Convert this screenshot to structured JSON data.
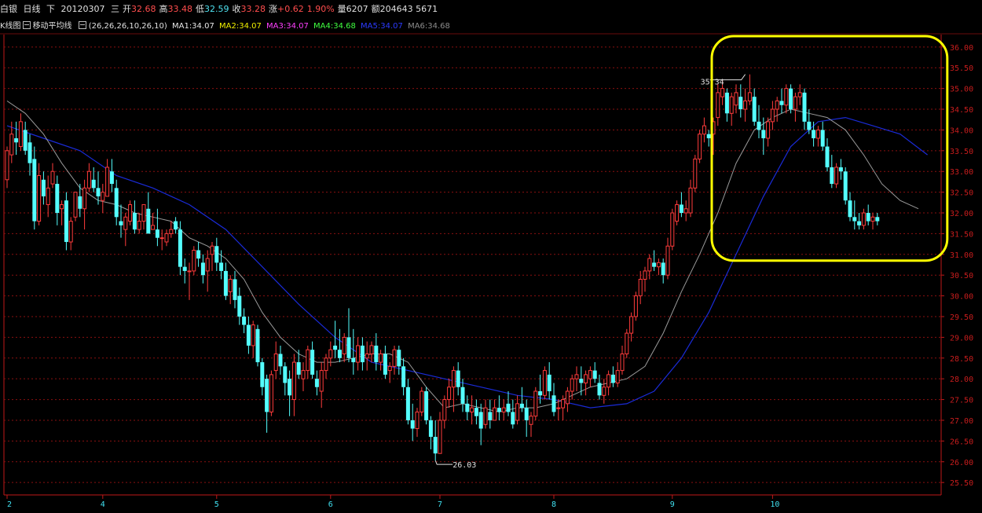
{
  "header": {
    "name": "白银",
    "period": "日线",
    "direction": "下",
    "date": "20120307",
    "weekday": "三",
    "open_label": "开",
    "open": "32.68",
    "high_label": "高",
    "high": "33.48",
    "low_label": "低",
    "low": "32.59",
    "close_label": "收",
    "close": "33.28",
    "change_label": "涨",
    "change": "+0.62",
    "change_pct": "1.90%",
    "volume_label": "量",
    "volume": "6207",
    "amount_label": "额",
    "amount": "204643 5671"
  },
  "indicator_bar": {
    "kline_label": "K线图",
    "ma_label": "移动平均线",
    "ma_params": "(26,26,26,10,26,10)",
    "ma1": "MA1:34.07",
    "ma2": "MA2:34.07",
    "ma3": "MA3:34.07",
    "ma4": "MA4:34.68",
    "ma5": "MA5:34.07",
    "ma6": "MA6:34.68"
  },
  "colors": {
    "up": "#ff3b3b",
    "down": "#54ffff",
    "ma_short": "#9a9a9a",
    "ma_long": "#1a2bd8",
    "grid": "#8a1010",
    "axis": "#c01818",
    "highlight": "#ffff00"
  },
  "chart_data": {
    "type": "candlestick",
    "yticks": [
      "25.50",
      "26.00",
      "26.50",
      "27.00",
      "27.50",
      "28.00",
      "28.50",
      "29.00",
      "29.50",
      "30.00",
      "30.50",
      "31.00",
      "31.50",
      "32.00",
      "32.50",
      "33.00",
      "33.50",
      "34.00",
      "34.50",
      "35.00",
      "35.50",
      "36.00"
    ],
    "ylim": [
      25.2,
      36.3
    ],
    "xticks": [
      {
        "label": "2",
        "index": 0
      },
      {
        "label": "4",
        "index": 21
      },
      {
        "label": "5",
        "index": 46
      },
      {
        "label": "6",
        "index": 71
      },
      {
        "label": "7",
        "index": 95
      },
      {
        "label": "8",
        "index": 120
      },
      {
        "label": "9",
        "index": 146
      },
      {
        "label": "10",
        "index": 168
      }
    ],
    "annotations": [
      {
        "text": "35.34",
        "index": 162
      },
      {
        "text": "26.03",
        "index": 94
      }
    ],
    "highlight_range": {
      "x_index": [
        155,
        206
      ],
      "y": [
        30.85,
        36.75
      ]
    },
    "ohlc": [
      [
        32.8,
        33.6,
        32.6,
        33.5
      ],
      [
        33.4,
        34.2,
        33.2,
        33.9
      ],
      [
        33.8,
        34.2,
        33.4,
        33.7
      ],
      [
        33.6,
        34.4,
        33.5,
        34.2
      ],
      [
        34.0,
        34.2,
        33.4,
        33.5
      ],
      [
        33.7,
        33.9,
        32.9,
        33.2
      ],
      [
        33.3,
        33.6,
        31.6,
        31.8
      ],
      [
        31.8,
        33.2,
        31.7,
        32.9
      ],
      [
        32.8,
        33.0,
        32.2,
        32.4
      ],
      [
        32.2,
        32.9,
        31.9,
        32.6
      ],
      [
        32.7,
        33.2,
        32.6,
        33.0
      ],
      [
        32.7,
        32.9,
        31.7,
        32.0
      ],
      [
        32.1,
        32.3,
        31.7,
        32.2
      ],
      [
        32.3,
        32.5,
        31.1,
        31.3
      ],
      [
        31.3,
        31.9,
        31.1,
        31.8
      ],
      [
        31.9,
        32.5,
        31.8,
        32.5
      ],
      [
        32.4,
        32.7,
        31.9,
        32.1
      ],
      [
        32.1,
        32.8,
        31.6,
        32.6
      ],
      [
        32.6,
        33.2,
        32.5,
        33.0
      ],
      [
        32.8,
        33.1,
        32.5,
        32.6
      ],
      [
        32.6,
        33.0,
        32.2,
        32.4
      ],
      [
        32.3,
        32.7,
        32.0,
        32.5
      ],
      [
        32.4,
        33.3,
        32.4,
        33.1
      ],
      [
        33.0,
        33.3,
        32.5,
        32.7
      ],
      [
        32.6,
        32.8,
        31.7,
        31.9
      ],
      [
        31.8,
        32.2,
        31.4,
        31.7
      ],
      [
        31.6,
        32.0,
        31.2,
        31.9
      ],
      [
        31.8,
        32.3,
        31.7,
        32.2
      ],
      [
        32.0,
        32.3,
        31.5,
        31.6
      ],
      [
        31.6,
        32.0,
        31.5,
        31.8
      ],
      [
        31.8,
        32.2,
        31.6,
        32.2
      ],
      [
        32.1,
        32.5,
        31.6,
        31.5
      ],
      [
        31.6,
        32.0,
        31.6,
        31.7
      ],
      [
        31.6,
        32.1,
        31.2,
        31.4
      ],
      [
        31.4,
        31.6,
        31.1,
        31.4
      ],
      [
        31.3,
        31.6,
        31.2,
        31.5
      ],
      [
        31.5,
        31.8,
        31.4,
        31.6
      ],
      [
        31.8,
        31.9,
        31.5,
        31.6
      ],
      [
        31.6,
        31.8,
        30.5,
        30.7
      ],
      [
        30.7,
        30.9,
        30.3,
        30.6
      ],
      [
        30.6,
        30.8,
        29.9,
        30.6
      ],
      [
        30.6,
        31.2,
        30.5,
        31.1
      ],
      [
        31.1,
        31.3,
        30.7,
        30.9
      ],
      [
        30.8,
        31.0,
        30.3,
        30.5
      ],
      [
        30.6,
        31.1,
        30.1,
        30.9
      ],
      [
        31.0,
        31.3,
        30.6,
        31.2
      ],
      [
        31.2,
        31.4,
        30.6,
        30.8
      ],
      [
        30.8,
        31.1,
        30.4,
        30.6
      ],
      [
        30.6,
        30.8,
        29.9,
        30.0
      ],
      [
        30.1,
        30.5,
        29.8,
        30.4
      ],
      [
        30.4,
        30.6,
        29.7,
        29.9
      ],
      [
        30.0,
        30.2,
        29.3,
        29.5
      ],
      [
        29.5,
        29.7,
        29.1,
        29.3
      ],
      [
        29.3,
        29.5,
        28.6,
        28.8
      ],
      [
        28.8,
        29.4,
        28.5,
        29.3
      ],
      [
        29.2,
        29.3,
        28.3,
        28.4
      ],
      [
        28.4,
        28.5,
        27.6,
        27.8
      ],
      [
        28.0,
        28.1,
        26.7,
        27.2
      ],
      [
        27.2,
        28.2,
        27.1,
        28.1
      ],
      [
        28.2,
        28.9,
        28.0,
        28.6
      ],
      [
        28.6,
        28.8,
        28.1,
        28.3
      ],
      [
        28.3,
        28.4,
        27.6,
        27.9
      ],
      [
        28.0,
        28.2,
        27.1,
        27.6
      ],
      [
        27.5,
        28.6,
        27.1,
        28.4
      ],
      [
        28.4,
        28.7,
        28.0,
        28.1
      ],
      [
        28.0,
        28.4,
        27.7,
        28.2
      ],
      [
        28.2,
        28.8,
        28.0,
        28.7
      ],
      [
        28.7,
        28.9,
        28.0,
        28.1
      ],
      [
        28.0,
        28.2,
        27.6,
        27.8
      ],
      [
        27.7,
        28.4,
        27.3,
        28.2
      ],
      [
        28.2,
        28.6,
        28.0,
        28.5
      ],
      [
        28.5,
        28.9,
        28.3,
        28.7
      ],
      [
        28.8,
        29.4,
        28.5,
        28.7
      ],
      [
        28.7,
        29.2,
        28.4,
        28.5
      ],
      [
        28.6,
        29.1,
        28.4,
        29.0
      ],
      [
        29.0,
        29.7,
        28.4,
        28.5
      ],
      [
        28.5,
        29.2,
        28.1,
        28.4
      ],
      [
        28.4,
        29.0,
        28.2,
        28.8
      ],
      [
        28.8,
        29.0,
        28.2,
        28.4
      ],
      [
        28.5,
        28.9,
        28.2,
        28.6
      ],
      [
        28.6,
        28.9,
        28.4,
        28.8
      ],
      [
        28.8,
        29.1,
        28.2,
        28.4
      ],
      [
        28.4,
        28.7,
        28.2,
        28.6
      ],
      [
        28.6,
        28.8,
        28.0,
        28.1
      ],
      [
        28.2,
        28.4,
        27.9,
        28.3
      ],
      [
        28.3,
        28.8,
        28.1,
        28.7
      ],
      [
        28.7,
        28.8,
        28.1,
        28.3
      ],
      [
        28.3,
        28.5,
        27.6,
        27.8
      ],
      [
        27.8,
        28.0,
        26.9,
        27.0
      ],
      [
        27.0,
        27.4,
        26.5,
        26.8
      ],
      [
        26.8,
        27.3,
        26.6,
        27.2
      ],
      [
        27.2,
        27.8,
        27.1,
        27.7
      ],
      [
        27.7,
        27.8,
        26.9,
        27.0
      ],
      [
        27.0,
        27.1,
        26.3,
        26.6
      ],
      [
        26.6,
        27.0,
        26.03,
        26.2
      ],
      [
        26.2,
        27.2,
        26.2,
        27.0
      ],
      [
        27.0,
        27.6,
        26.8,
        27.5
      ],
      [
        27.5,
        28.0,
        27.3,
        27.8
      ],
      [
        27.8,
        28.3,
        27.2,
        28.2
      ],
      [
        28.2,
        28.4,
        27.6,
        27.8
      ],
      [
        27.8,
        28.0,
        27.2,
        27.4
      ],
      [
        27.4,
        27.6,
        27.0,
        27.2
      ],
      [
        27.2,
        27.6,
        26.9,
        27.3
      ],
      [
        27.3,
        27.5,
        26.9,
        27.1
      ],
      [
        27.2,
        27.4,
        26.4,
        26.8
      ],
      [
        26.9,
        27.5,
        26.8,
        27.3
      ],
      [
        27.2,
        27.5,
        26.8,
        27.0
      ],
      [
        27.0,
        27.5,
        27.0,
        27.3
      ],
      [
        27.3,
        27.6,
        27.0,
        27.2
      ],
      [
        27.2,
        27.5,
        27.0,
        27.3
      ],
      [
        27.4,
        27.7,
        27.1,
        27.2
      ],
      [
        27.2,
        27.5,
        26.8,
        26.9
      ],
      [
        27.0,
        27.6,
        26.9,
        27.4
      ],
      [
        27.4,
        27.8,
        27.2,
        27.3
      ],
      [
        27.3,
        27.5,
        26.6,
        27.0
      ],
      [
        26.9,
        27.2,
        26.6,
        27.1
      ],
      [
        27.1,
        27.8,
        27.0,
        27.7
      ],
      [
        27.7,
        28.1,
        27.4,
        27.6
      ],
      [
        27.6,
        28.3,
        27.5,
        28.2
      ],
      [
        28.1,
        28.4,
        27.5,
        27.7
      ],
      [
        27.6,
        27.9,
        27.1,
        27.2
      ],
      [
        27.3,
        27.5,
        27.0,
        27.3
      ],
      [
        27.3,
        27.6,
        27.0,
        27.5
      ],
      [
        27.4,
        27.8,
        27.2,
        27.7
      ],
      [
        27.7,
        28.1,
        27.5,
        28.0
      ],
      [
        28.0,
        28.3,
        27.7,
        28.1
      ],
      [
        28.0,
        28.3,
        27.6,
        27.9
      ],
      [
        27.9,
        28.2,
        27.6,
        28.1
      ],
      [
        28.0,
        28.3,
        27.8,
        28.2
      ],
      [
        28.2,
        28.4,
        27.9,
        28.0
      ],
      [
        27.9,
        28.1,
        27.5,
        27.6
      ],
      [
        27.6,
        28.0,
        27.4,
        27.8
      ],
      [
        27.8,
        28.2,
        27.6,
        28.1
      ],
      [
        28.1,
        28.3,
        27.8,
        27.9
      ],
      [
        27.9,
        28.4,
        27.8,
        28.2
      ],
      [
        28.2,
        28.8,
        28.1,
        28.6
      ],
      [
        28.6,
        29.2,
        28.5,
        29.1
      ],
      [
        29.1,
        29.6,
        28.9,
        29.5
      ],
      [
        29.5,
        30.1,
        29.4,
        30.0
      ],
      [
        30.0,
        30.6,
        29.8,
        30.4
      ],
      [
        30.4,
        30.7,
        30.1,
        30.6
      ],
      [
        30.6,
        31.0,
        30.4,
        30.9
      ],
      [
        30.8,
        31.1,
        30.6,
        30.7
      ],
      [
        30.7,
        30.9,
        30.5,
        30.8
      ],
      [
        30.8,
        30.9,
        30.3,
        30.5
      ],
      [
        30.5,
        31.4,
        30.4,
        31.2
      ],
      [
        31.2,
        32.1,
        31.1,
        32.0
      ],
      [
        31.8,
        32.3,
        31.7,
        32.2
      ],
      [
        32.2,
        32.5,
        31.9,
        32.0
      ],
      [
        32.0,
        32.3,
        31.8,
        32.1
      ],
      [
        32.0,
        32.8,
        31.9,
        32.6
      ],
      [
        32.6,
        33.4,
        32.5,
        33.3
      ],
      [
        33.3,
        34.0,
        33.2,
        33.9
      ],
      [
        33.9,
        34.3,
        33.7,
        34.1
      ],
      [
        33.9,
        34.0,
        33.6,
        33.8
      ],
      [
        33.9,
        34.3,
        33.4,
        34.2
      ],
      [
        34.3,
        35.1,
        34.1,
        34.9
      ],
      [
        34.8,
        35.2,
        34.6,
        35.0
      ],
      [
        34.9,
        35.0,
        34.2,
        34.4
      ],
      [
        34.4,
        34.9,
        34.1,
        34.8
      ],
      [
        34.6,
        35.1,
        34.4,
        34.9
      ],
      [
        34.8,
        35.1,
        34.3,
        34.5
      ],
      [
        34.5,
        35.0,
        34.2,
        34.7
      ],
      [
        34.7,
        35.34,
        34.6,
        34.9
      ],
      [
        34.8,
        35.0,
        34.1,
        34.2
      ],
      [
        34.2,
        34.6,
        33.8,
        34.0
      ],
      [
        34.0,
        34.3,
        33.4,
        33.8
      ],
      [
        33.8,
        34.3,
        33.6,
        34.2
      ],
      [
        34.2,
        34.7,
        34.0,
        34.5
      ],
      [
        34.5,
        34.8,
        34.2,
        34.7
      ],
      [
        34.7,
        35.0,
        34.4,
        34.6
      ],
      [
        34.6,
        35.1,
        34.4,
        35.0
      ],
      [
        35.0,
        35.1,
        34.4,
        34.5
      ],
      [
        34.5,
        34.9,
        34.2,
        34.8
      ],
      [
        34.8,
        35.1,
        34.6,
        34.9
      ],
      [
        34.9,
        35.0,
        34.0,
        34.2
      ],
      [
        34.2,
        34.5,
        33.9,
        34.0
      ],
      [
        34.0,
        34.2,
        33.6,
        33.8
      ],
      [
        33.8,
        34.1,
        33.6,
        34.0
      ],
      [
        34.0,
        34.2,
        33.5,
        33.6
      ],
      [
        33.6,
        33.8,
        33.0,
        33.1
      ],
      [
        33.1,
        33.4,
        32.6,
        32.7
      ],
      [
        32.7,
        33.2,
        32.6,
        33.1
      ],
      [
        33.1,
        33.3,
        32.8,
        33.0
      ],
      [
        33.0,
        33.1,
        32.2,
        32.3
      ],
      [
        32.3,
        32.5,
        31.8,
        31.9
      ],
      [
        31.9,
        32.3,
        31.6,
        31.8
      ],
      [
        31.8,
        32.0,
        31.6,
        31.7
      ],
      [
        31.7,
        32.1,
        31.6,
        32.0
      ],
      [
        32.0,
        32.2,
        31.7,
        31.8
      ],
      [
        31.8,
        32.0,
        31.6,
        31.9
      ],
      [
        31.9,
        32.0,
        31.7,
        31.8
      ]
    ],
    "ma_short": [
      [
        0,
        34.7
      ],
      [
        4,
        34.4
      ],
      [
        8,
        33.9
      ],
      [
        12,
        33.2
      ],
      [
        16,
        32.6
      ],
      [
        20,
        32.3
      ],
      [
        24,
        32.2
      ],
      [
        28,
        32.0
      ],
      [
        32,
        31.9
      ],
      [
        36,
        31.8
      ],
      [
        40,
        31.4
      ],
      [
        44,
        31.2
      ],
      [
        48,
        30.9
      ],
      [
        52,
        30.4
      ],
      [
        56,
        29.6
      ],
      [
        60,
        29.0
      ],
      [
        64,
        28.6
      ],
      [
        68,
        28.4
      ],
      [
        72,
        28.4
      ],
      [
        76,
        28.5
      ],
      [
        80,
        28.6
      ],
      [
        84,
        28.6
      ],
      [
        88,
        28.4
      ],
      [
        92,
        27.8
      ],
      [
        96,
        27.3
      ],
      [
        100,
        27.4
      ],
      [
        104,
        27.3
      ],
      [
        108,
        27.2
      ],
      [
        112,
        27.3
      ],
      [
        116,
        27.3
      ],
      [
        120,
        27.4
      ],
      [
        124,
        27.6
      ],
      [
        128,
        27.8
      ],
      [
        132,
        27.9
      ],
      [
        136,
        28.0
      ],
      [
        140,
        28.3
      ],
      [
        144,
        29.1
      ],
      [
        148,
        30.1
      ],
      [
        152,
        31.0
      ],
      [
        156,
        32.0
      ],
      [
        160,
        33.2
      ],
      [
        164,
        34.0
      ],
      [
        168,
        34.3
      ],
      [
        172,
        34.5
      ],
      [
        176,
        34.4
      ],
      [
        180,
        34.3
      ],
      [
        184,
        34.0
      ],
      [
        188,
        33.4
      ],
      [
        192,
        32.7
      ],
      [
        196,
        32.3
      ],
      [
        200,
        32.1
      ]
    ],
    "ma_long": [
      [
        0,
        34.1
      ],
      [
        8,
        33.8
      ],
      [
        16,
        33.5
      ],
      [
        24,
        32.9
      ],
      [
        32,
        32.6
      ],
      [
        40,
        32.2
      ],
      [
        48,
        31.6
      ],
      [
        56,
        30.7
      ],
      [
        64,
        29.8
      ],
      [
        72,
        29.0
      ],
      [
        80,
        28.4
      ],
      [
        88,
        28.2
      ],
      [
        96,
        28.0
      ],
      [
        104,
        27.8
      ],
      [
        112,
        27.6
      ],
      [
        120,
        27.5
      ],
      [
        128,
        27.3
      ],
      [
        136,
        27.4
      ],
      [
        142,
        27.7
      ],
      [
        148,
        28.5
      ],
      [
        154,
        29.6
      ],
      [
        160,
        31.0
      ],
      [
        166,
        32.4
      ],
      [
        172,
        33.6
      ],
      [
        178,
        34.2
      ],
      [
        184,
        34.3
      ],
      [
        190,
        34.1
      ],
      [
        196,
        33.9
      ],
      [
        202,
        33.4
      ]
    ]
  }
}
